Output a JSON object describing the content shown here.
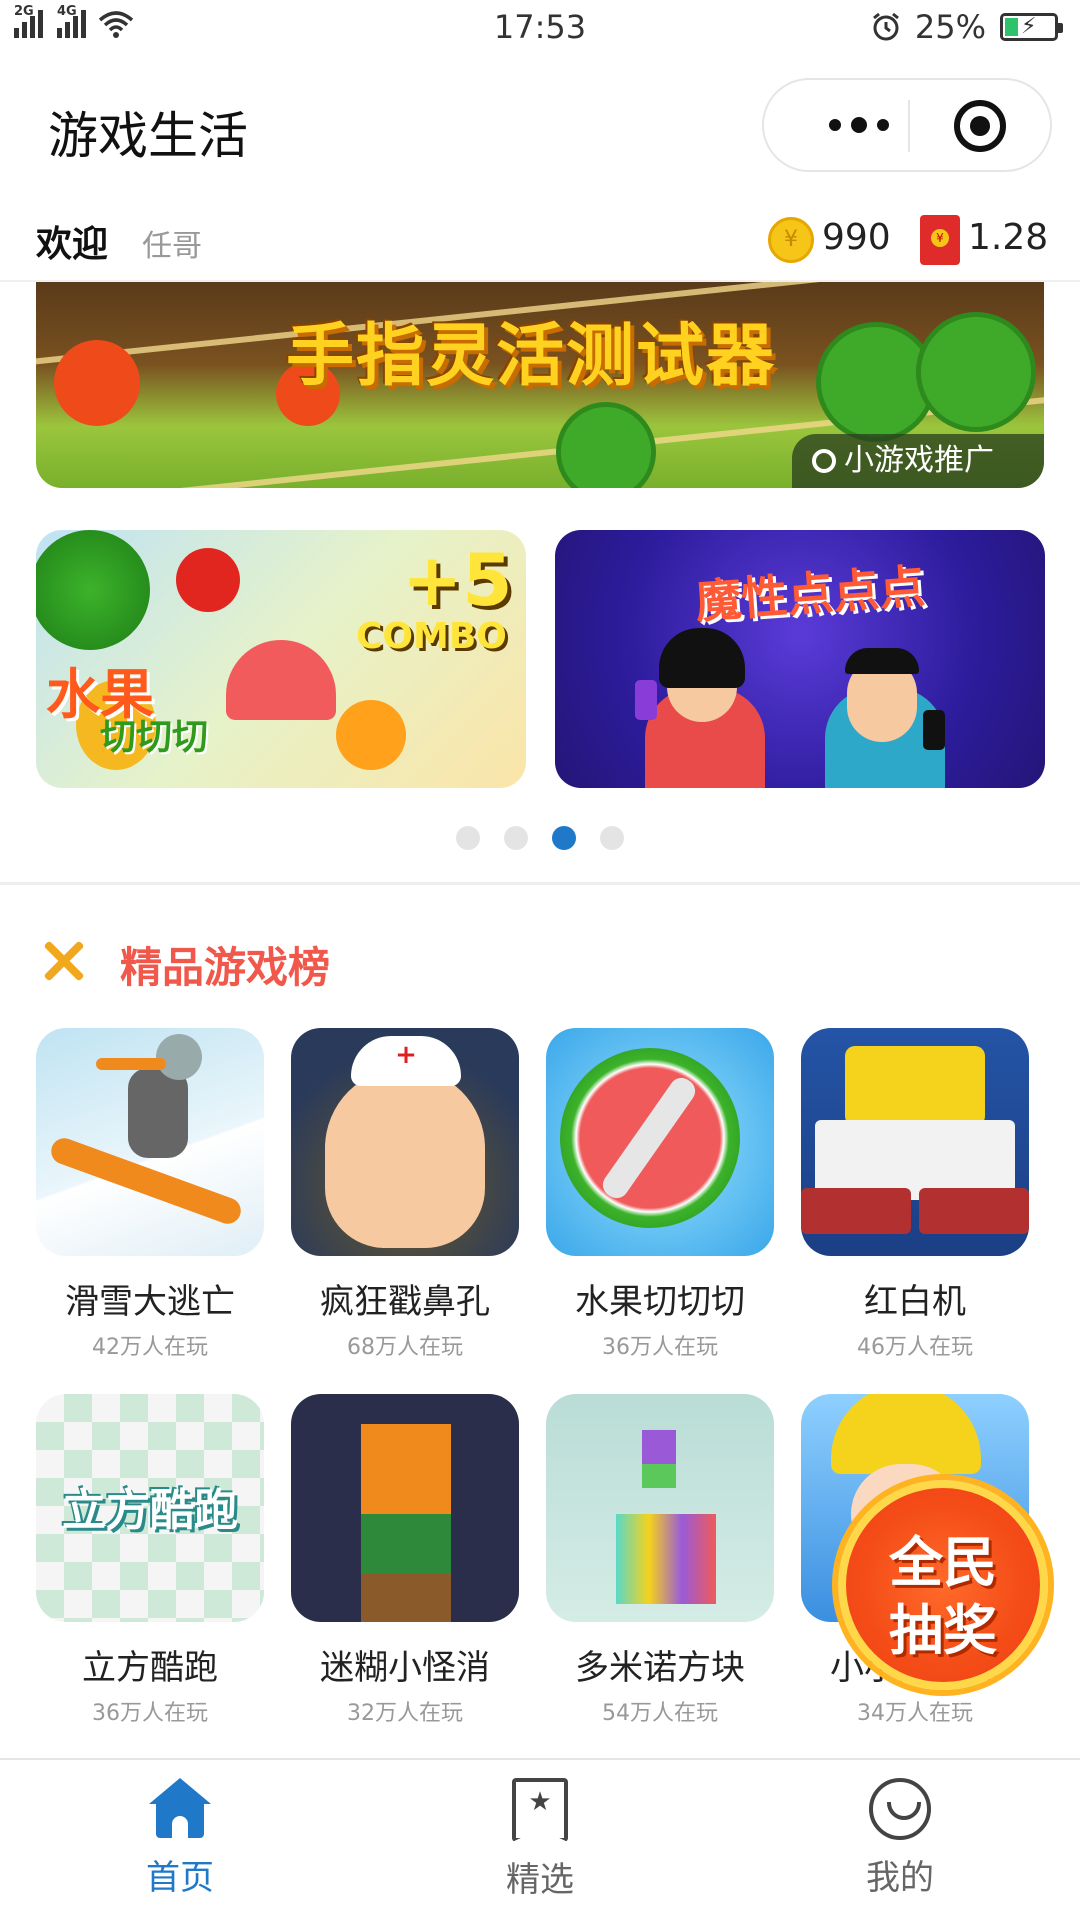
{
  "status_bar": {
    "signal1": "2G",
    "signal2": "4G",
    "time": "17:53",
    "battery": "25%",
    "battery_level": 0.25
  },
  "nav": {
    "title": "游戏生活"
  },
  "welcome": {
    "label": "欢迎",
    "name": "任哥",
    "coin_symbol": "¥",
    "coins": "990",
    "cash": "1.28"
  },
  "banner": {
    "title": "手指灵活测试器",
    "tag": "小游戏推广"
  },
  "cards": [
    {
      "title_line1": "水果",
      "title_line2": "切切切",
      "combo_num": "+5",
      "combo": "COMBO"
    },
    {
      "title": "魔性点点点"
    }
  ],
  "carousel": {
    "count": 4,
    "active_index": 2
  },
  "section": {
    "title": "精品游戏榜"
  },
  "games": [
    {
      "name": "滑雪大逃亡",
      "players": "42万人在玩"
    },
    {
      "name": "疯狂戳鼻孔",
      "players": "68万人在玩"
    },
    {
      "name": "水果切切切",
      "players": "36万人在玩"
    },
    {
      "name": "红白机",
      "players": "46万人在玩"
    },
    {
      "name": "立方酷跑",
      "players": "36万人在玩"
    },
    {
      "name": "迷糊小怪消",
      "players": "32万人在玩"
    },
    {
      "name": "多米诺方块",
      "players": "54万人在玩"
    },
    {
      "name": "小小建筑师",
      "players": "34万人在玩"
    }
  ],
  "icon_text": {
    "cube": "立方酷跑"
  },
  "lottery": {
    "line1": "全民",
    "line2": "抽奖"
  },
  "tabbar": {
    "home": "首页",
    "featured": "精选",
    "me": "我的",
    "featured_icon_glyph": "★"
  },
  "colors": {
    "accent": "#1f78c8",
    "section_title": "#f0584b",
    "muted": "#999999"
  }
}
